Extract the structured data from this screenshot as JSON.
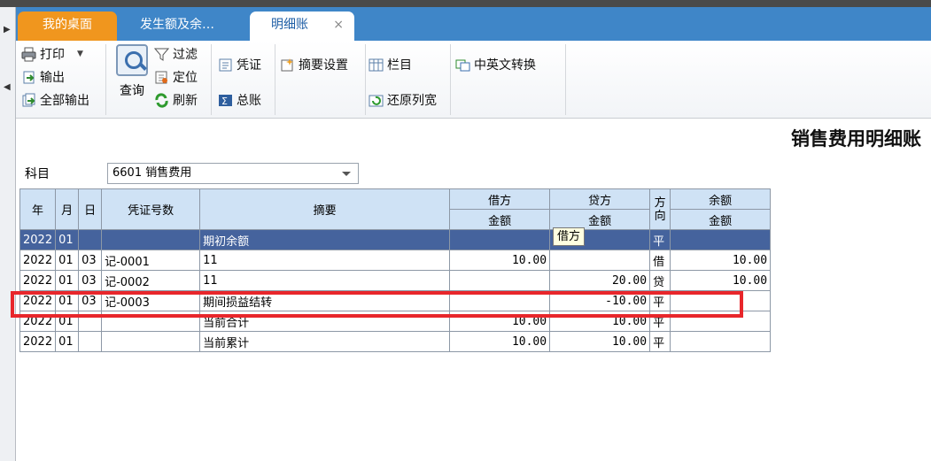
{
  "tabs": [
    {
      "label": "我的桌面"
    },
    {
      "label": "发生额及余…"
    },
    {
      "label": "明细账",
      "close": "×"
    }
  ],
  "toolbar": {
    "print": "打印",
    "export": "输出",
    "export_all": "全部输出",
    "query": "查询",
    "filter": "过滤",
    "locate": "定位",
    "refresh": "刷新",
    "voucher": "凭证",
    "general_ledger": "总账",
    "summary_settings": "摘要设置",
    "columns": "栏目",
    "restore_width": "还原列宽",
    "cn_en_switch": "中英文转换"
  },
  "report_title": "销售费用明细账",
  "subject": {
    "label": "科目",
    "value": "6601 销售费用"
  },
  "headers": {
    "year": "年",
    "month": "月",
    "day": "日",
    "voucher_no": "凭证号数",
    "summary": "摘要",
    "debit": "借方",
    "credit": "贷方",
    "direction": "方向",
    "balance": "余额",
    "amount": "金额"
  },
  "rows": [
    {
      "year": "2022",
      "month": "01",
      "day": "",
      "voucher": "",
      "summary": "期初余额",
      "debit": "",
      "credit": "",
      "dir": "平",
      "balance": ""
    },
    {
      "year": "2022",
      "month": "01",
      "day": "03",
      "voucher": "记-0001",
      "summary": "11",
      "debit": "10.00",
      "credit": "",
      "dir": "借",
      "balance": "10.00"
    },
    {
      "year": "2022",
      "month": "01",
      "day": "03",
      "voucher": "记-0002",
      "summary": "11",
      "debit": "",
      "credit": "20.00",
      "dir": "贷",
      "balance": "10.00"
    },
    {
      "year": "2022",
      "month": "01",
      "day": "03",
      "voucher": "记-0003",
      "summary": "期间损益结转",
      "debit": "",
      "credit": "-10.00",
      "dir": "平",
      "balance": ""
    },
    {
      "year": "2022",
      "month": "01",
      "day": "",
      "voucher": "",
      "summary": "当前合计",
      "debit": "10.00",
      "credit": "10.00",
      "dir": "平",
      "balance": ""
    },
    {
      "year": "2022",
      "month": "01",
      "day": "",
      "voucher": "",
      "summary": "当前累计",
      "debit": "10.00",
      "credit": "10.00",
      "dir": "平",
      "balance": ""
    }
  ],
  "tooltip": "借方",
  "colors": {
    "tab_bar": "#3f86c8",
    "home_tab": "#f0961e",
    "header_bg": "#cfe2f5",
    "selected_row": "#45639d",
    "highlight": "#e8262b"
  }
}
